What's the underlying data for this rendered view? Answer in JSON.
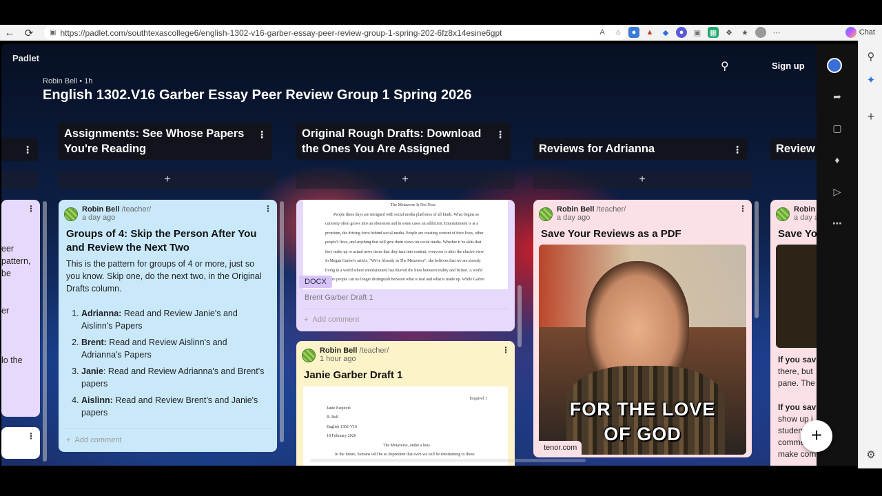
{
  "browser": {
    "url": "https://padlet.com/southtexascollege6/english-1302-v16-garber-essay-peer-review-group-1-spring-202-6fz8x14esine6gpt",
    "chat_label": "Chat"
  },
  "board": {
    "logo": "Padlet",
    "author": "Robin Bell",
    "age": "1h",
    "title": "English 1302.V16 Garber Essay Peer Review Group 1 Spring 2026",
    "signup": "Sign up",
    "add_symbol": "+"
  },
  "columns": [
    {
      "title": "Assignments: See Whose Papers You're Reading"
    },
    {
      "title": "Original Rough Drafts: Download the Ones You Are Assigned"
    },
    {
      "title": "Reviews for Adrianna"
    },
    {
      "title": "Review"
    }
  ],
  "left_card_fragments": [
    "eer",
    "pattern,",
    "be",
    "er",
    "lo the"
  ],
  "card_meta": {
    "author": "Robin Bell",
    "role": "/teacher/",
    "add_comment": "Add comment"
  },
  "assign_card": {
    "time": "a day ago",
    "title": "Groups of 4: Skip the Person After You and Review the Next Two",
    "body": "This is the pattern for groups of 4 or more, just so you know. Skip one, do the next two, in the Original Drafts column.",
    "steps": [
      {
        "name": "Adrianna:",
        "text": " Read and Review Janie's and Aislinn's Papers"
      },
      {
        "name": "Brent:",
        "text": " Read and Review Aislinn's and Adrianna's Papers"
      },
      {
        "name": "Janie",
        "text": ": Read and Review Adrianna's and Brent's papers"
      },
      {
        "name": "Aislinn:",
        "text": " Read and Review Brent's and Janie's papers"
      }
    ]
  },
  "brent_card": {
    "doc_title": "The Metaverse Is Not Now",
    "doc_lines": [
      "People these days are intrigued with social media platforms of all kinds. What begins as",
      "curiosity often grows into an obsession and in some cases an addiction. Entertainment is at a",
      "premium, the driving force behind social media. People are creating content of their lives, other",
      "people's lives, and anything that will give them views on social media. Whether it be skits that",
      "they make up or actual news items that they turn into content, everyone is after the elusive view.",
      "In Megan Garber's article, \"We're Already in The Metaverse\", she believes that we are already",
      "living in a world where entertainment has blurred the lines between reality and fiction. A world",
      "where people can no longer distinguish between what is real and what is made up. While Garber"
    ],
    "badge": "DOCX",
    "filename": "Brent Garber Draft 1"
  },
  "janie_card": {
    "time": "1 hour ago",
    "title": "Janie Garber Draft 1",
    "doc_header_right": "Esquivel 1",
    "doc_lines": [
      "Janie Esquivel",
      "R. Bell",
      "English 1302-V16",
      "18 February 2026"
    ],
    "doc_title": "The Metaverse, under a lens.",
    "doc_last": "In the future, humans will be so dependent that even we will be entertaining to those"
  },
  "review_card": {
    "time": "a day ago",
    "title": "Save Your Reviews as a PDF",
    "gif_line1": "FOR THE LOVE",
    "gif_line2": "OF GOD",
    "gif_source": "tenor.com"
  },
  "partial_card": {
    "author": "Robin",
    "time": "a day ago",
    "title": "Save You",
    "lines": [
      "If you sav",
      "there, but",
      "pane. The",
      "If you sav",
      "show up i",
      "studen",
      "comme",
      "make com"
    ]
  },
  "colors": {
    "blue_card": "#c9e9fb",
    "purple_card": "#e6d9fb",
    "yellow_card": "#fdf3c8",
    "pink_card": "#fbe1e6"
  }
}
